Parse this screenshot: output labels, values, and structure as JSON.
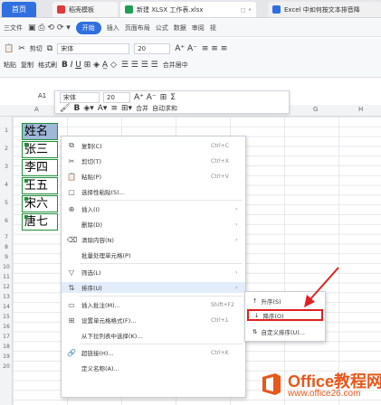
{
  "tabs": {
    "home": "首页",
    "docer": "稻壳模板",
    "book": "新建 XLSX 工作表.xlsx",
    "doc2": "Excel 中如何按文本排音降"
  },
  "menubar": {
    "file": "三文件",
    "start": "开始",
    "insert": "插入",
    "layout": "页面布局",
    "formula": "公式",
    "data": "数据",
    "review": "审阅",
    "view": "视"
  },
  "ribbon": {
    "cut": "剪切",
    "copy": "复制",
    "format_painter": "格式刷",
    "paste": "粘贴",
    "font_name": "宋体",
    "font_size": "20",
    "merge_center": "合并居中"
  },
  "formula_bar": {
    "cell_ref": "A1",
    "font": "宋体",
    "size": "20"
  },
  "columns": [
    "A",
    "B",
    "C",
    "D",
    "E",
    "F",
    "G",
    "H"
  ],
  "rows": [
    "1",
    "2",
    "3",
    "4",
    "5",
    "6",
    "7",
    "8",
    "9",
    "10",
    "11",
    "12",
    "13",
    "14",
    "15",
    "16",
    "17",
    "18",
    "19",
    "20"
  ],
  "cells": [
    "姓名",
    "张三",
    "李四",
    "王五",
    "宋六",
    "唐七"
  ],
  "mini_toolbar": {
    "font": "宋体",
    "size": "20",
    "merge": "合并",
    "autosum": "自动求和"
  },
  "context_menu": [
    {
      "label": "复制(C)",
      "shortcut": "Ctrl+C",
      "icon": "copy-icon"
    },
    {
      "label": "剪切(T)",
      "shortcut": "Ctrl+X",
      "icon": "cut-icon"
    },
    {
      "label": "粘贴(P)",
      "shortcut": "Ctrl+V",
      "icon": "paste-icon"
    },
    {
      "label": "选择性粘贴(S)...",
      "shortcut": "",
      "icon": "paste-special-icon"
    },
    {
      "label": "插入(I)",
      "shortcut": "",
      "icon": "insert-icon",
      "arrow": true
    },
    {
      "label": "删除(D)",
      "shortcut": "",
      "icon": "",
      "arrow": true
    },
    {
      "label": "清除内容(N)",
      "shortcut": "",
      "icon": "clear-icon",
      "arrow": true
    },
    {
      "label": "批量处理单元格(P)",
      "shortcut": "",
      "icon": ""
    },
    {
      "label": "筛选(L)",
      "shortcut": "",
      "icon": "filter-icon",
      "arrow": true
    },
    {
      "label": "排序(U)",
      "shortcut": "",
      "icon": "sort-icon",
      "arrow": true,
      "highlight": true
    },
    {
      "label": "插入批注(M)...",
      "shortcut": "Shift+F2",
      "icon": "comment-icon"
    },
    {
      "label": "设置单元格格式(F)...",
      "shortcut": "Ctrl+1",
      "icon": "format-cells-icon"
    },
    {
      "label": "从下拉列表中选择(K)...",
      "shortcut": "",
      "icon": ""
    },
    {
      "label": "超链接(H)...",
      "shortcut": "Ctrl+K",
      "icon": "hyperlink-icon"
    },
    {
      "label": "定义名称(A)...",
      "shortcut": "",
      "icon": ""
    }
  ],
  "sort_submenu": [
    {
      "label": "升序(S)",
      "icon": "sort-ascending-icon"
    },
    {
      "label": "降序(O)",
      "icon": "sort-descending-icon",
      "boxed": true
    },
    {
      "label": "自定义排序(U)...",
      "icon": "custom-sort-icon"
    }
  ],
  "watermark": {
    "title": "Office教程网",
    "url": "www.office26.com"
  },
  "colors": {
    "accent": "#2f6fe0",
    "selection": "#9fb8d8",
    "cell_border": "#1f8f3a",
    "highlight_box": "#e02020",
    "watermark": "#e8571a"
  }
}
